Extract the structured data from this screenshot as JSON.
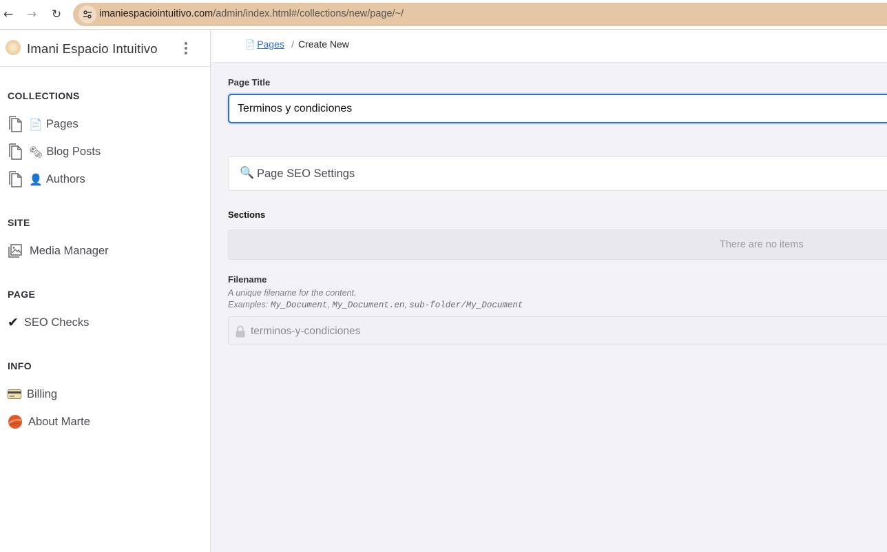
{
  "browser": {
    "back_icon": "←",
    "forward_icon": "→",
    "reload_icon": "↻",
    "site_info_icon": "⚙",
    "url_host": "imaniespaciointuitivo.com",
    "url_path": "/admin/index.html#/collections/new/page/~/"
  },
  "sidebar": {
    "brand_title": "Imani Espacio Intuitivo",
    "collections_heading": "COLLECTIONS",
    "collections": [
      {
        "emoji": "📄",
        "label": "Pages"
      },
      {
        "emoji": "🗞",
        "label": "Blog Posts"
      },
      {
        "emoji": "👤",
        "label": "Authors"
      }
    ],
    "site_heading": "SITE",
    "site_items": [
      {
        "icon": "image-gallery-icon",
        "label": "Media Manager"
      }
    ],
    "page_heading": "PAGE",
    "page_items": [
      {
        "emoji": "✔",
        "label": "SEO Checks"
      }
    ],
    "info_heading": "INFO",
    "info_items": [
      {
        "emoji": "💳",
        "label": "Billing"
      },
      {
        "emoji": "🔴",
        "label": "About Marte"
      }
    ]
  },
  "breadcrumb": {
    "link_emoji": "📄",
    "link_label": "Pages",
    "separator": "/",
    "current": "Create New"
  },
  "form": {
    "page_title_label": "Page Title",
    "page_title_value": "Terminos y condiciones",
    "seo_emoji": "🔍",
    "seo_label": "Page SEO Settings",
    "sections_label": "Sections",
    "sections_empty_text": "There are no items",
    "filename_label": "Filename",
    "filename_help_1": "A unique filename for the content.",
    "filename_help_prefix": "Examples: ",
    "filename_example_1": "My_Document",
    "filename_example_2": "My_Document.en",
    "filename_example_3": "sub-folder/My_Document",
    "filename_value": "terminos-y-condiciones"
  },
  "colors": {
    "accent": "#2f6fd0",
    "url_bar": "#e5c6a5",
    "background": "#f3f3f7"
  }
}
